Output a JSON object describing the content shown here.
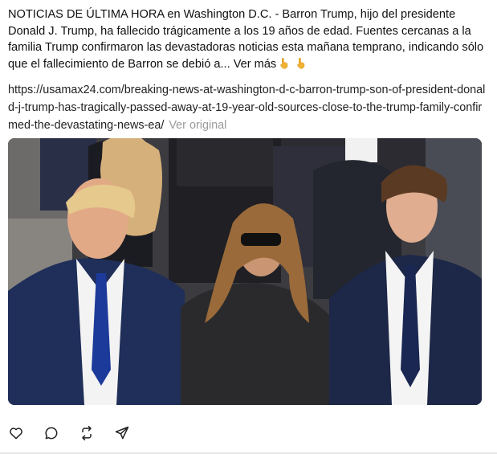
{
  "post": {
    "text": "NOTICIAS DE ÚLTIMA HORA en Washington D.C. - Barron Trump, hijo del presidente Donald J. Trump, ha fallecido trágicamente a los 19 años de edad. Fuentes cercanas a la familia Trump confirmaron las devastadoras noticias esta mañana temprano, indicando sólo que el fallecimiento de Barron se debió a...",
    "more_label": "Ver más",
    "emoji_1": "point-down-emoji",
    "emoji_2": "point-down-emoji",
    "link_url": "https://usamax24.com/breaking-news-at-washington-d-c-barron-trump-son-of-president-donald-j-trump-has-tragically-passed-away-at-19-year-old-sources-close-to-the-trump-family-confirmed-the-devastating-news-ea/",
    "translate_label": "Ver original"
  },
  "image": {
    "description_icon": "photo-image"
  },
  "actions": [
    {
      "icon": "heart-icon"
    },
    {
      "icon": "comment-icon"
    },
    {
      "icon": "repost-icon"
    },
    {
      "icon": "share-icon"
    }
  ],
  "colors": {
    "text": "#111111",
    "muted": "#9a9a9a",
    "emoji": "#f2b233"
  }
}
